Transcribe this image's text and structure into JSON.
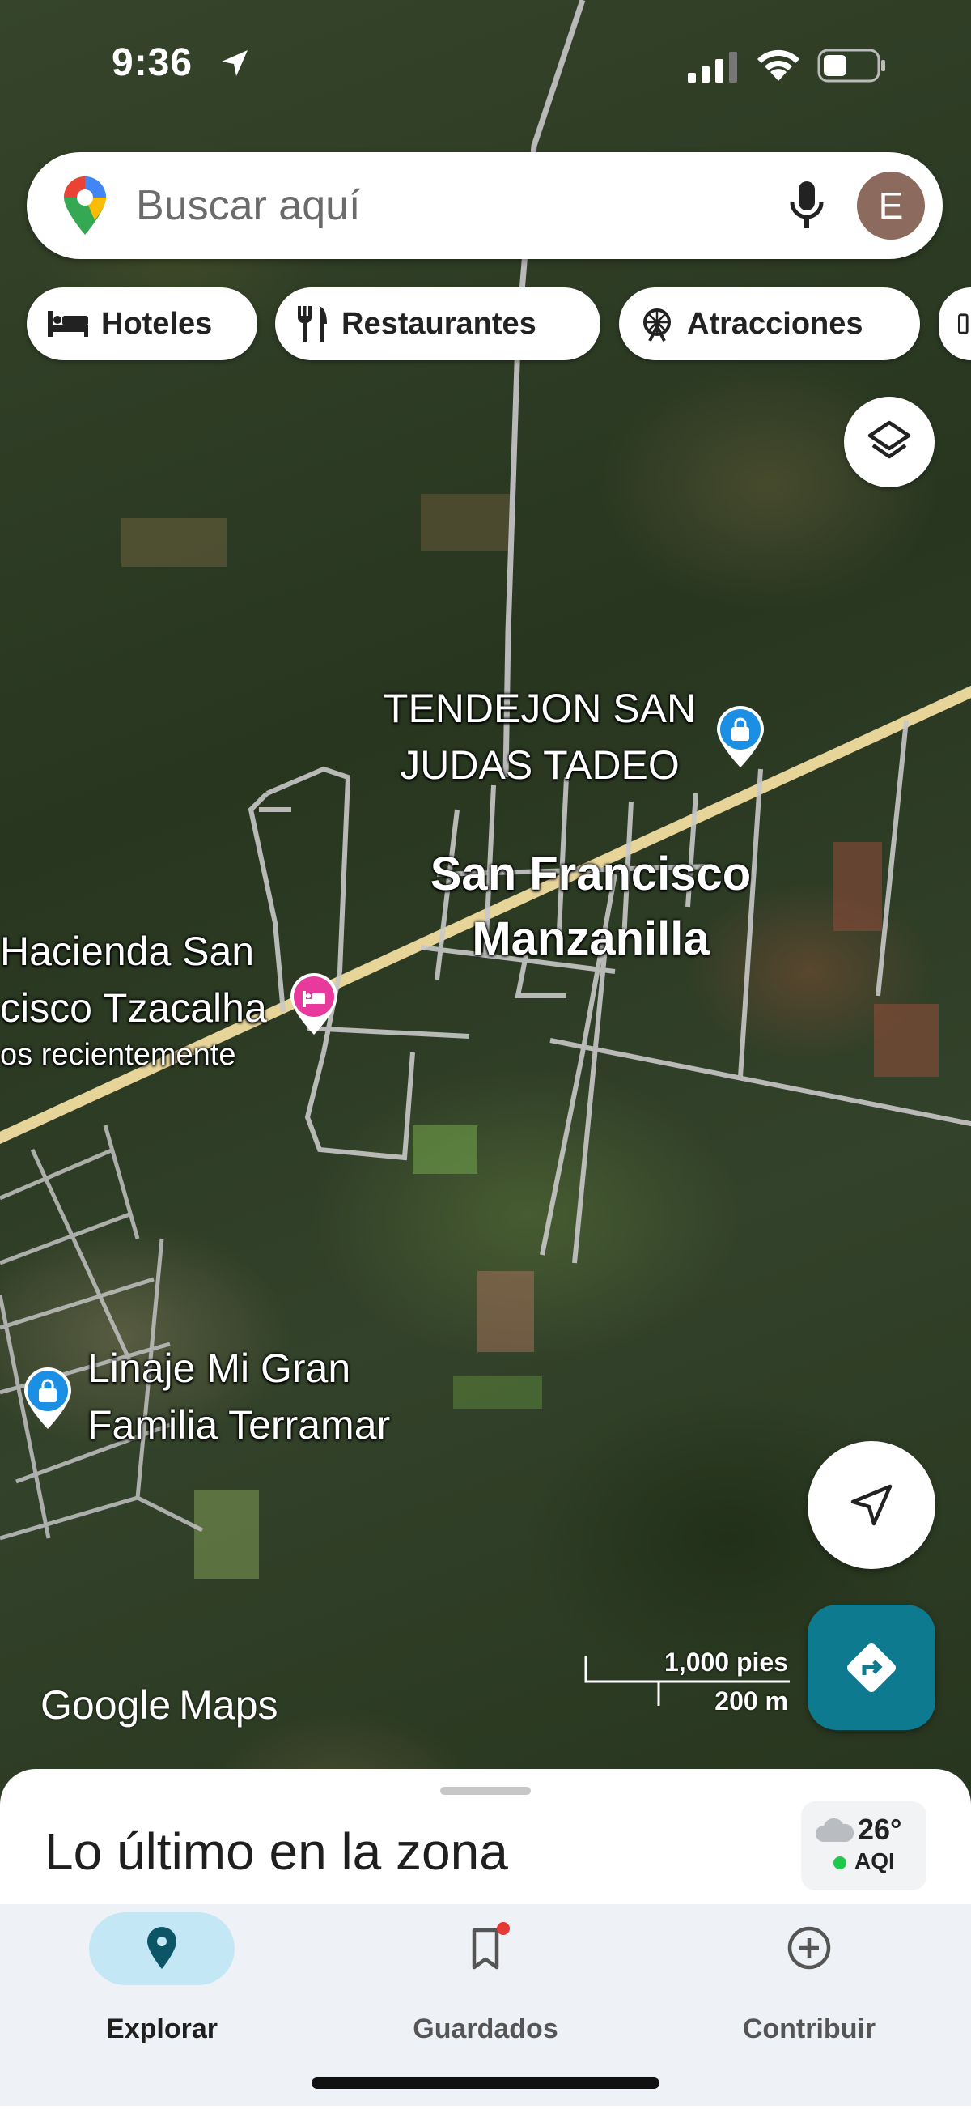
{
  "status_bar": {
    "time": "9:36",
    "icons": [
      "location-arrow-icon",
      "signal-icon",
      "wifi-icon",
      "battery-icon"
    ]
  },
  "search": {
    "placeholder": "Buscar aquí",
    "avatar_letter": "E",
    "icons": [
      "google-maps-pin-icon",
      "microphone-icon"
    ]
  },
  "chips": [
    {
      "label": "Hoteles",
      "icon": "bed-icon"
    },
    {
      "label": "Restaurantes",
      "icon": "fork-knife-icon"
    },
    {
      "label": "Atracciones",
      "icon": "ferris-wheel-icon"
    }
  ],
  "map_labels": {
    "tendejon": "TENDEJON SAN JUDAS TADEO",
    "tendejon_lines": [
      "TENDEJON SAN",
      "JUDAS TADEO"
    ],
    "town_lines": [
      "San Francisco",
      "Manzanilla"
    ],
    "hacienda_lines": [
      "Hacienda San",
      "cisco Tzacalha",
      "os recientemente"
    ],
    "linaje_lines": [
      "Linaje Mi Gran",
      "Familia Terramar"
    ]
  },
  "map_controls": {
    "layers_icon": "layers-icon",
    "location_icon": "navigation-arrow-icon",
    "directions_icon": "directions-icon"
  },
  "branding": {
    "google": "Google",
    "maps": "Maps"
  },
  "scale": {
    "imperial": "1,000 pies",
    "metric": "200 m"
  },
  "sheet": {
    "title": "Lo último en la zona",
    "temperature": "26°",
    "aqi_label": "AQI",
    "aqi_color": "#1ec84a"
  },
  "nav": {
    "items": [
      {
        "label": "Explorar",
        "icon": "location-pin-icon",
        "active": true
      },
      {
        "label": "Guardados",
        "icon": "bookmark-icon",
        "active": false,
        "notification": true
      },
      {
        "label": "Contribuir",
        "icon": "add-circle-icon",
        "active": false
      }
    ]
  },
  "colors": {
    "accent_teal": "#0d7a8f",
    "active_pill": "#c3e7f5",
    "poi_blue": "#1a8fe3",
    "hotel_pink": "#e8399c"
  }
}
